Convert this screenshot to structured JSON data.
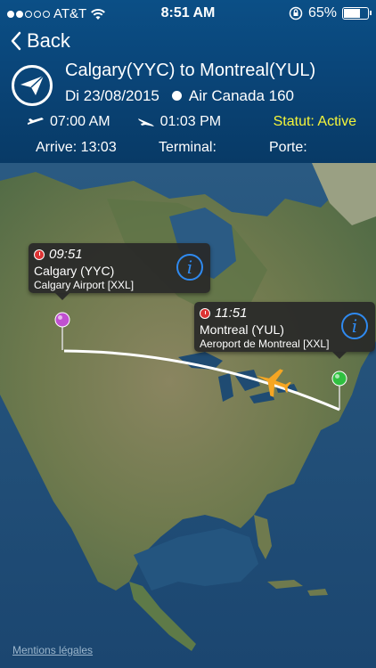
{
  "status_bar": {
    "carrier": "AT&T",
    "time": "8:51 AM",
    "battery": "65%",
    "battery_fraction": 0.65,
    "signal_bars_filled": 2,
    "signal_bars_total": 5
  },
  "nav": {
    "back_label": "Back"
  },
  "flight": {
    "route": "Calgary(YYC) to Montreal(YUL)",
    "date": "Di 23/08/2015",
    "flight_name": "Air Canada 160",
    "departure_time": "07:00 AM",
    "arrival_time": "01:03 PM",
    "status": "Statut: Active",
    "arrive": "Arrive: 13:03",
    "terminal": "Terminal:",
    "gate": "Porte:"
  },
  "map": {
    "origin": {
      "time": "09:51",
      "city": "Calgary (YYC)",
      "airport": "Calgary Airport [XXL]",
      "pin_color": "#c050d0"
    },
    "destination": {
      "time": "11:51",
      "city": "Montreal (YUL)",
      "airport": "Aeroport de Montreal [XXL]",
      "pin_color": "#30c040"
    },
    "plane_color": "#f5a623",
    "legal_link": "Mentions légales"
  },
  "colors": {
    "header_bg": "#0a467a",
    "status_accent": "#f5f53a",
    "info_blue": "#2f8af0"
  }
}
